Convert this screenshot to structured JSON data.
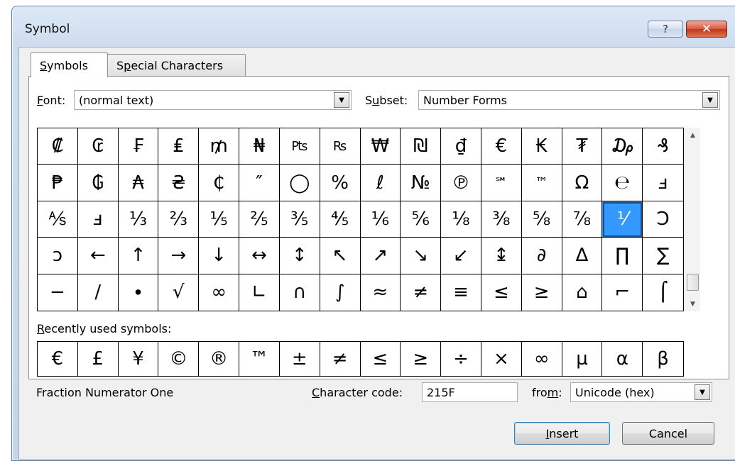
{
  "window": {
    "title": "Symbol",
    "help_glyph": "?",
    "close_glyph": "✕"
  },
  "tabs": [
    {
      "label": "Symbols",
      "underline": "S",
      "rest": "ymbols"
    },
    {
      "label": "Special Characters",
      "prefix": "S",
      "underline": "p",
      "rest": "ecial Characters"
    }
  ],
  "font": {
    "label_u": "F",
    "label_rest": "ont:",
    "value": "(normal text)"
  },
  "subset": {
    "label_pre": "S",
    "label_u": "u",
    "label_rest": "bset:",
    "value": "Number Forms"
  },
  "symbols": [
    "₡",
    "₢",
    "₣",
    "₤",
    "₥",
    "₦",
    "₧",
    "₨",
    "₩",
    "₪",
    "₫",
    "€",
    "₭",
    "₮",
    "₯",
    "₰",
    "₱",
    "₲",
    "₳",
    "₴",
    "₵",
    "″",
    "◯",
    "%",
    "ℓ",
    "№",
    "℗",
    "℠",
    "™",
    "Ω",
    "℮",
    "ⅎ",
    "⅍",
    "ⅎ",
    "⅓",
    "⅔",
    "⅕",
    "⅖",
    "⅗",
    "⅘",
    "⅙",
    "⅚",
    "⅛",
    "⅜",
    "⅝",
    "⅞",
    "⅟",
    "Ↄ",
    "ↄ",
    "←",
    "↑",
    "→",
    "↓",
    "↔",
    "↕",
    "↖",
    "↗",
    "↘",
    "↙",
    "↨",
    "∂",
    "∆",
    "∏",
    "∑",
    "−",
    "∕",
    "∙",
    "√",
    "∞",
    "∟",
    "∩",
    "∫",
    "≈",
    "≠",
    "≡",
    "≤",
    "≥",
    "⌂",
    "⌐",
    "⌠"
  ],
  "selected_index": 46,
  "recent": {
    "label_u": "R",
    "label_rest": "ecently used symbols:",
    "symbols": [
      "€",
      "£",
      "¥",
      "©",
      "®",
      "™",
      "±",
      "≠",
      "≤",
      "≥",
      "÷",
      "×",
      "∞",
      "µ",
      "α",
      "β"
    ]
  },
  "status": {
    "char_name": "Fraction Numerator One",
    "code_label_u": "C",
    "code_label_rest": "haracter code:",
    "code_value": "215F",
    "from_label_pre": "fro",
    "from_label_u": "m",
    "from_label_rest": ":",
    "from_value": "Unicode (hex)"
  },
  "buttons": {
    "insert_u": "I",
    "insert_rest": "nsert",
    "cancel": "Cancel"
  },
  "colors": {
    "selection": "#3399ff",
    "close_button": "#c2361c"
  }
}
